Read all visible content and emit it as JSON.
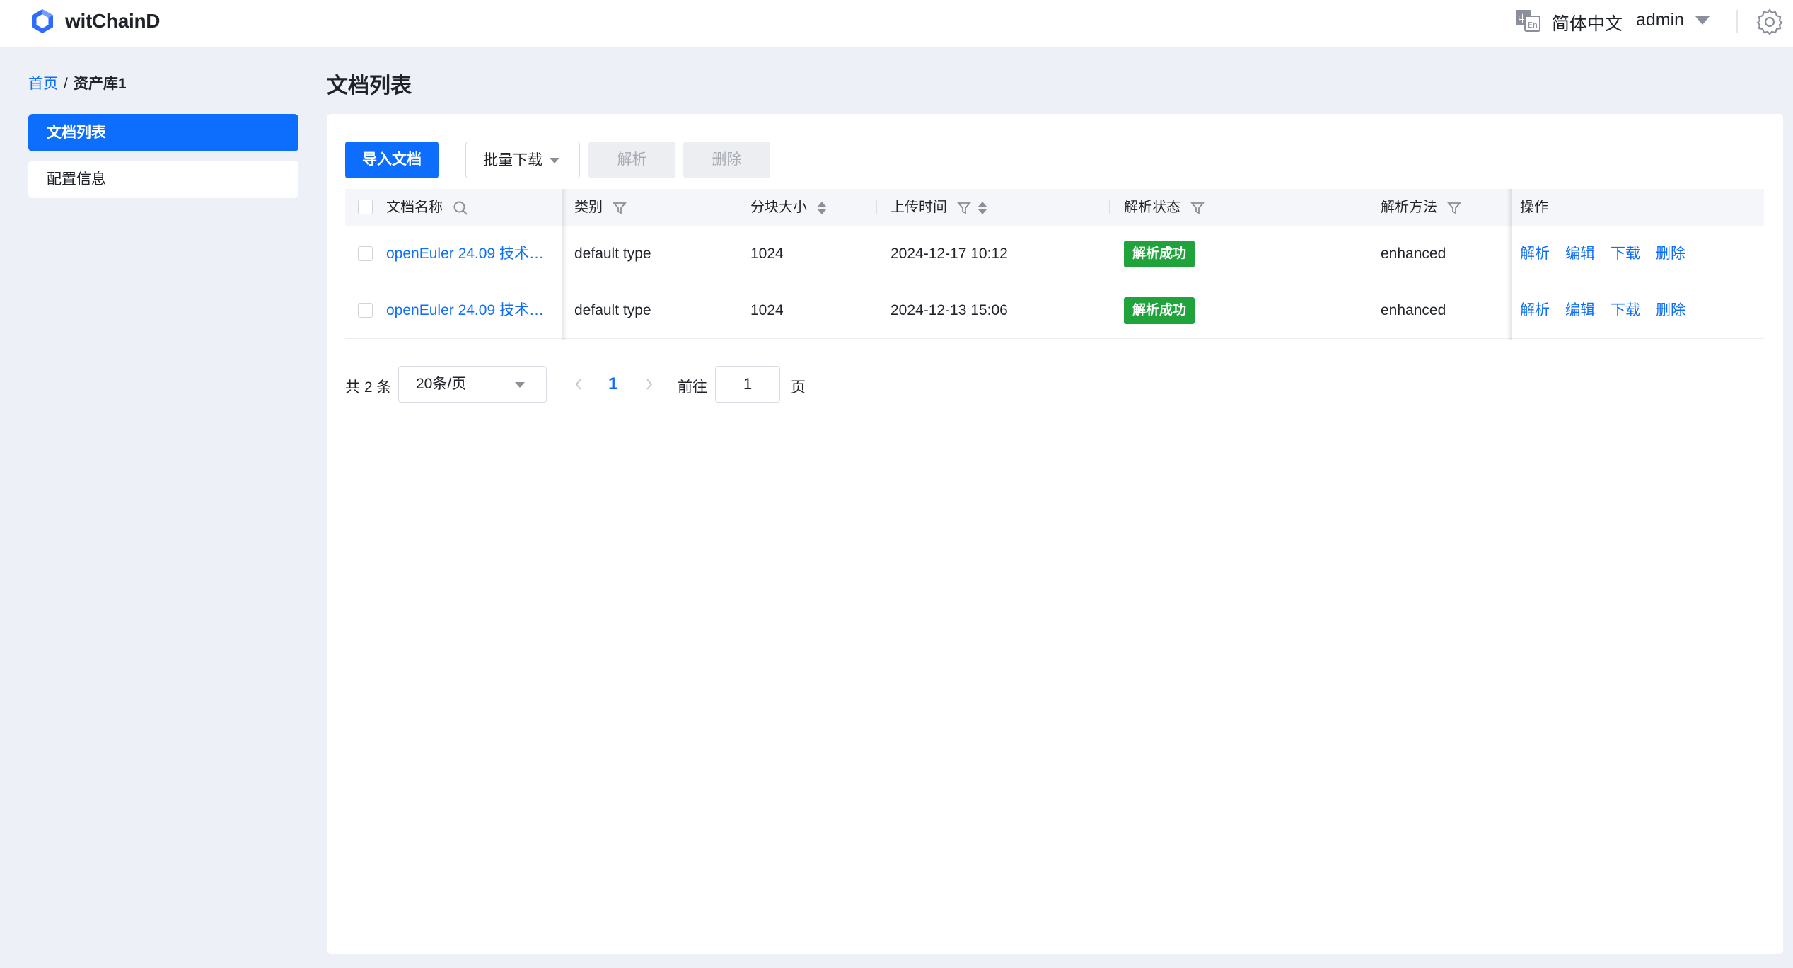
{
  "header": {
    "app_title": "witChainD",
    "language": "简体中文",
    "user": "admin",
    "icons": [
      "logo-icon",
      "language-icon",
      "chevron-down-icon",
      "gear-icon"
    ]
  },
  "breadcrumb": {
    "home": "首页",
    "separator": "/",
    "current": "资产库1"
  },
  "sidebar": {
    "items": [
      {
        "label": "文档列表",
        "active": true
      },
      {
        "label": "配置信息",
        "active": false
      }
    ]
  },
  "main": {
    "title": "文档列表",
    "toolbar": {
      "import_label": "导入文档",
      "batch_download_label": "批量下载",
      "parse_label": "解析",
      "delete_label": "删除"
    },
    "table": {
      "columns": [
        "文档名称",
        "类别",
        "分块大小",
        "上传时间",
        "解析状态",
        "解析方法",
        "操作"
      ],
      "rows": [
        {
          "name": "openEuler 24.09 技术…",
          "category": "default type",
          "chunk_size": "1024",
          "upload_time": "2024-12-17 10:12",
          "status": "解析成功",
          "method": "enhanced",
          "actions": [
            "解析",
            "编辑",
            "下载",
            "删除"
          ]
        },
        {
          "name": "openEuler 24.09 技术…",
          "category": "default type",
          "chunk_size": "1024",
          "upload_time": "2024-12-13 15:06",
          "status": "解析成功",
          "method": "enhanced",
          "actions": [
            "解析",
            "编辑",
            "下载",
            "删除"
          ]
        }
      ]
    },
    "pagination": {
      "total": "共 2 条",
      "page_size": "20条/页",
      "current_page": "1",
      "goto_label": "前往",
      "goto_value": "1",
      "page_unit": "页"
    }
  },
  "colors": {
    "primary": "#0d6efd",
    "success": "#1fa33a",
    "background": "#edf1f7"
  }
}
